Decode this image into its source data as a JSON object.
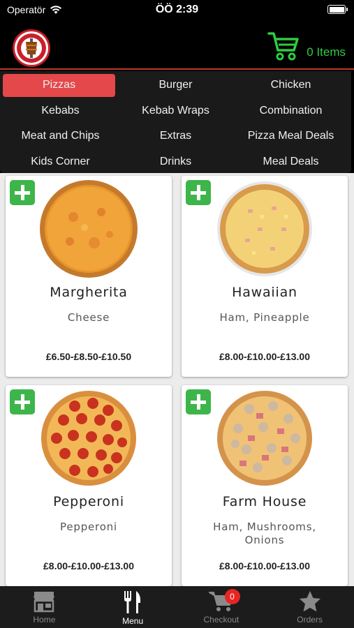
{
  "status_bar": {
    "carrier": "Operatör",
    "time": "ÖÖ 2:39"
  },
  "header": {
    "cart_count": "0 Items",
    "accent_color": "#2ecc40"
  },
  "categories": [
    {
      "label": "Pizzas",
      "active": true
    },
    {
      "label": "Burger"
    },
    {
      "label": "Chicken"
    },
    {
      "label": "Kebabs"
    },
    {
      "label": "Kebab Wraps"
    },
    {
      "label": "Combination"
    },
    {
      "label": "Meat and Chips"
    },
    {
      "label": "Extras"
    },
    {
      "label": "Pizza Meal Deals"
    },
    {
      "label": "Kids Corner"
    },
    {
      "label": "Drinks"
    },
    {
      "label": "Meal Deals"
    }
  ],
  "products": [
    {
      "name": "Margherita",
      "description": "Cheese",
      "price": "£6.50-£8.50-£10.50",
      "image": "margherita-pizza"
    },
    {
      "name": "Hawaiian",
      "description": "Ham, Pineapple",
      "price": "£8.00-£10.00-£13.00",
      "image": "hawaiian-pizza"
    },
    {
      "name": "Pepperoni",
      "description": "Pepperoni",
      "price": "£8.00-£10.00-£13.00",
      "image": "pepperoni-pizza"
    },
    {
      "name": "Farm House",
      "description": "Ham, Mushrooms, Onions",
      "price": "£8.00-£10.00-£13.00",
      "image": "farm-house-pizza"
    }
  ],
  "tab_bar": {
    "items": [
      {
        "label": "Home",
        "icon": "store-icon"
      },
      {
        "label": "Menu",
        "icon": "fork-knife-icon",
        "active": true
      },
      {
        "label": "Checkout",
        "icon": "cart-icon",
        "badge": "0"
      },
      {
        "label": "Orders",
        "icon": "star-icon"
      }
    ]
  },
  "colors": {
    "active_category": "#e4484a",
    "add_button": "#3db54a",
    "badge": "#e82424"
  }
}
